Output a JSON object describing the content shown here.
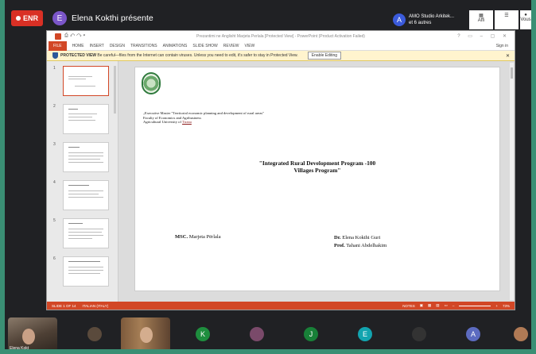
{
  "meeting": {
    "record_label": "ENR",
    "presenter_initial": "E",
    "presenter_text": "Elena Kokthi présente",
    "others_initial": "A",
    "others_line1": "AMO Studio Arkitek...",
    "others_line2": "et 6 autres",
    "top_icons": [
      "grid-view-icon",
      "people-icon",
      "chat-icon"
    ],
    "top_icon_labels": [
      "Affi",
      "",
      ""
    ],
    "you_label": "Vous"
  },
  "ppt": {
    "window_title": "Prezantimi ne Anglisht Marjeta Perlala [Protected View] - PowerPoint (Product Activation Failed)",
    "tabs": [
      "FILE",
      "HOME",
      "INSERT",
      "DESIGN",
      "TRANSITIONS",
      "ANIMATIONS",
      "SLIDE SHOW",
      "REVIEW",
      "VIEW"
    ],
    "sign_in": "Sign in",
    "protected_title": "PROTECTED VIEW",
    "protected_msg": "Be careful—files from the Internet can contain viruses. Unless you need to edit, it's safer to stay in Protected View.",
    "enable_label": "Enable Editing",
    "thumb_numbers": [
      "1",
      "2",
      "3",
      "4",
      "5",
      "6"
    ],
    "slide": {
      "aff1": "„Executive Master \"Territorial economic planning and development of rural areas\"",
      "aff2": "Faculty of Economics and Agribusiness",
      "aff3a": "Agricultural University of ",
      "aff3b": "Tirana",
      "title1": "\"Integrated Rural Development Program -100",
      "title2": "Villages Program\"",
      "author_left_prefix": "MSC.",
      "author_left_name": " Marjeta Përlala",
      "author_r1_prefix": "Dr.",
      "author_r1_name": " Elena Kokthi Guri",
      "author_r2_prefix": "Prof.",
      "author_r2_name": " Tahani Abdelhakim"
    },
    "status": {
      "slide": "SLIDE 1 OF 14",
      "lang": "ITALIAN (ITALY)",
      "notes": "NOTES",
      "zoom": "73%"
    }
  },
  "participants": {
    "cam1_name": "Elena Kokt",
    "avatars": [
      {
        "initial": "K",
        "color": "#1e8e3e"
      },
      {
        "initial": "J",
        "color": "#188038"
      },
      {
        "initial": "E",
        "color": "#12a4af"
      },
      {
        "initial": "A",
        "color": "#5c6bc0"
      }
    ]
  }
}
